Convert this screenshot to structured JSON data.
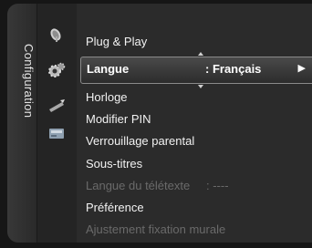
{
  "side_tab": {
    "label": "Configuration"
  },
  "icons": [
    "satellite-dish-icon",
    "gear-icon",
    "remote-icon",
    "card-icon"
  ],
  "menu": {
    "selected": {
      "label": "Langue",
      "value": ": Français",
      "arrow": "▶"
    },
    "items": [
      {
        "label": "Plug & Play",
        "enabled": true
      },
      {
        "label": "Horloge",
        "enabled": true
      },
      {
        "label": "Modifier PIN",
        "enabled": true
      },
      {
        "label": "Verrouillage parental",
        "enabled": true
      },
      {
        "label": "Sous-titres",
        "enabled": true
      },
      {
        "label": "Langue du télétexte",
        "value": ": ----",
        "enabled": false
      },
      {
        "label": "Préférence",
        "enabled": true
      },
      {
        "label": "Ajustement fixation murale",
        "enabled": false
      }
    ]
  },
  "colors": {
    "panel": "#242424",
    "menu_bg": "#2b2b2b",
    "text": "#f2f2f2",
    "disabled": "#6a6a6a",
    "highlight_border": "#8a8a8a"
  }
}
